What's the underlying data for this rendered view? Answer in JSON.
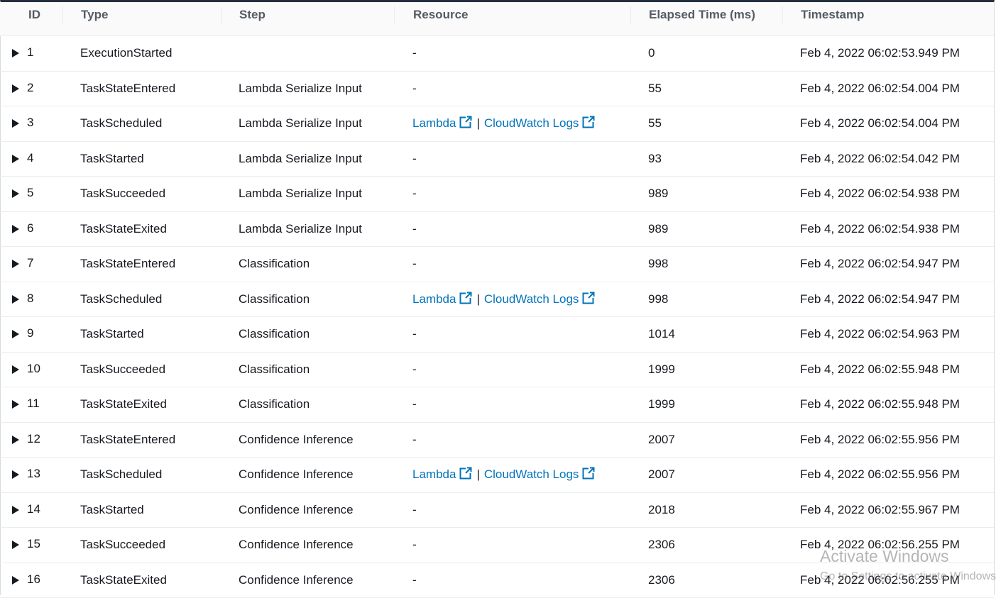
{
  "columns": {
    "id": "ID",
    "type": "Type",
    "step": "Step",
    "resource": "Resource",
    "elapsed": "Elapsed Time (ms)",
    "timestamp": "Timestamp"
  },
  "resource_links": {
    "lambda": "Lambda",
    "separator": "|",
    "cloudwatch": "CloudWatch Logs"
  },
  "rows": [
    {
      "id": "1",
      "type": "ExecutionStarted",
      "step": "",
      "resource": "-",
      "elapsed": "0",
      "timestamp": "Feb 4, 2022 06:02:53.949 PM"
    },
    {
      "id": "2",
      "type": "TaskStateEntered",
      "step": "Lambda Serialize Input",
      "resource": "-",
      "elapsed": "55",
      "timestamp": "Feb 4, 2022 06:02:54.004 PM"
    },
    {
      "id": "3",
      "type": "TaskScheduled",
      "step": "Lambda Serialize Input",
      "resource": "links",
      "elapsed": "55",
      "timestamp": "Feb 4, 2022 06:02:54.004 PM"
    },
    {
      "id": "4",
      "type": "TaskStarted",
      "step": "Lambda Serialize Input",
      "resource": "-",
      "elapsed": "93",
      "timestamp": "Feb 4, 2022 06:02:54.042 PM"
    },
    {
      "id": "5",
      "type": "TaskSucceeded",
      "step": "Lambda Serialize Input",
      "resource": "-",
      "elapsed": "989",
      "timestamp": "Feb 4, 2022 06:02:54.938 PM"
    },
    {
      "id": "6",
      "type": "TaskStateExited",
      "step": "Lambda Serialize Input",
      "resource": "-",
      "elapsed": "989",
      "timestamp": "Feb 4, 2022 06:02:54.938 PM"
    },
    {
      "id": "7",
      "type": "TaskStateEntered",
      "step": "Classification",
      "resource": "-",
      "elapsed": "998",
      "timestamp": "Feb 4, 2022 06:02:54.947 PM"
    },
    {
      "id": "8",
      "type": "TaskScheduled",
      "step": "Classification",
      "resource": "links",
      "elapsed": "998",
      "timestamp": "Feb 4, 2022 06:02:54.947 PM"
    },
    {
      "id": "9",
      "type": "TaskStarted",
      "step": "Classification",
      "resource": "-",
      "elapsed": "1014",
      "timestamp": "Feb 4, 2022 06:02:54.963 PM"
    },
    {
      "id": "10",
      "type": "TaskSucceeded",
      "step": "Classification",
      "resource": "-",
      "elapsed": "1999",
      "timestamp": "Feb 4, 2022 06:02:55.948 PM"
    },
    {
      "id": "11",
      "type": "TaskStateExited",
      "step": "Classification",
      "resource": "-",
      "elapsed": "1999",
      "timestamp": "Feb 4, 2022 06:02:55.948 PM"
    },
    {
      "id": "12",
      "type": "TaskStateEntered",
      "step": "Confidence Inference",
      "resource": "-",
      "elapsed": "2007",
      "timestamp": "Feb 4, 2022 06:02:55.956 PM"
    },
    {
      "id": "13",
      "type": "TaskScheduled",
      "step": "Confidence Inference",
      "resource": "links",
      "elapsed": "2007",
      "timestamp": "Feb 4, 2022 06:02:55.956 PM"
    },
    {
      "id": "14",
      "type": "TaskStarted",
      "step": "Confidence Inference",
      "resource": "-",
      "elapsed": "2018",
      "timestamp": "Feb 4, 2022 06:02:55.967 PM"
    },
    {
      "id": "15",
      "type": "TaskSucceeded",
      "step": "Confidence Inference",
      "resource": "-",
      "elapsed": "2306",
      "timestamp": "Feb 4, 2022 06:02:56.255 PM"
    },
    {
      "id": "16",
      "type": "TaskStateExited",
      "step": "Confidence Inference",
      "resource": "-",
      "elapsed": "2306",
      "timestamp": "Feb 4, 2022 06:02:56.255 PM"
    }
  ],
  "watermark": {
    "title": "Activate Windows",
    "subtitle": "Go to Settings to activate Windows."
  },
  "colors": {
    "link": "#0073bb",
    "header_bg": "#fafafa",
    "border": "#eaeded"
  },
  "icons": {
    "row_toggle": "caret-right-icon",
    "external_link": "external-link-icon"
  }
}
